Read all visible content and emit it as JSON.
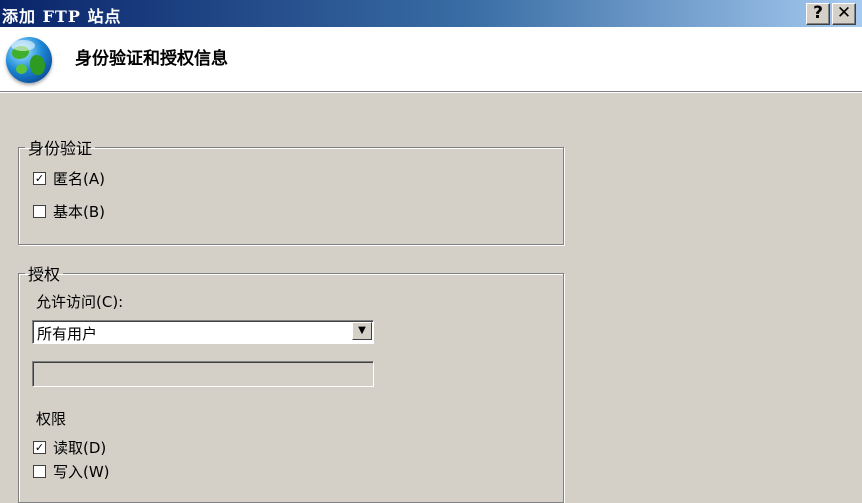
{
  "window": {
    "title": "添加 FTP 站点",
    "help_button": "?",
    "close_button": "✕"
  },
  "header": {
    "icon": "globe-icon",
    "title": "身份验证和授权信息"
  },
  "authentication": {
    "legend": "身份验证",
    "anonymous": {
      "label": "匿名(A)",
      "checked": true
    },
    "basic": {
      "label": "基本(B)",
      "checked": false
    }
  },
  "authorization": {
    "legend": "授权",
    "allow_access_label": "允许访问(C):",
    "allow_access_value": "所有用户",
    "user_field_value": "",
    "permissions_label": "权限",
    "read": {
      "label": "读取(D)",
      "checked": true
    },
    "write": {
      "label": "写入(W)",
      "checked": false
    }
  },
  "glyphs": {
    "check": "✓",
    "dropdown_arrow": "▼"
  }
}
